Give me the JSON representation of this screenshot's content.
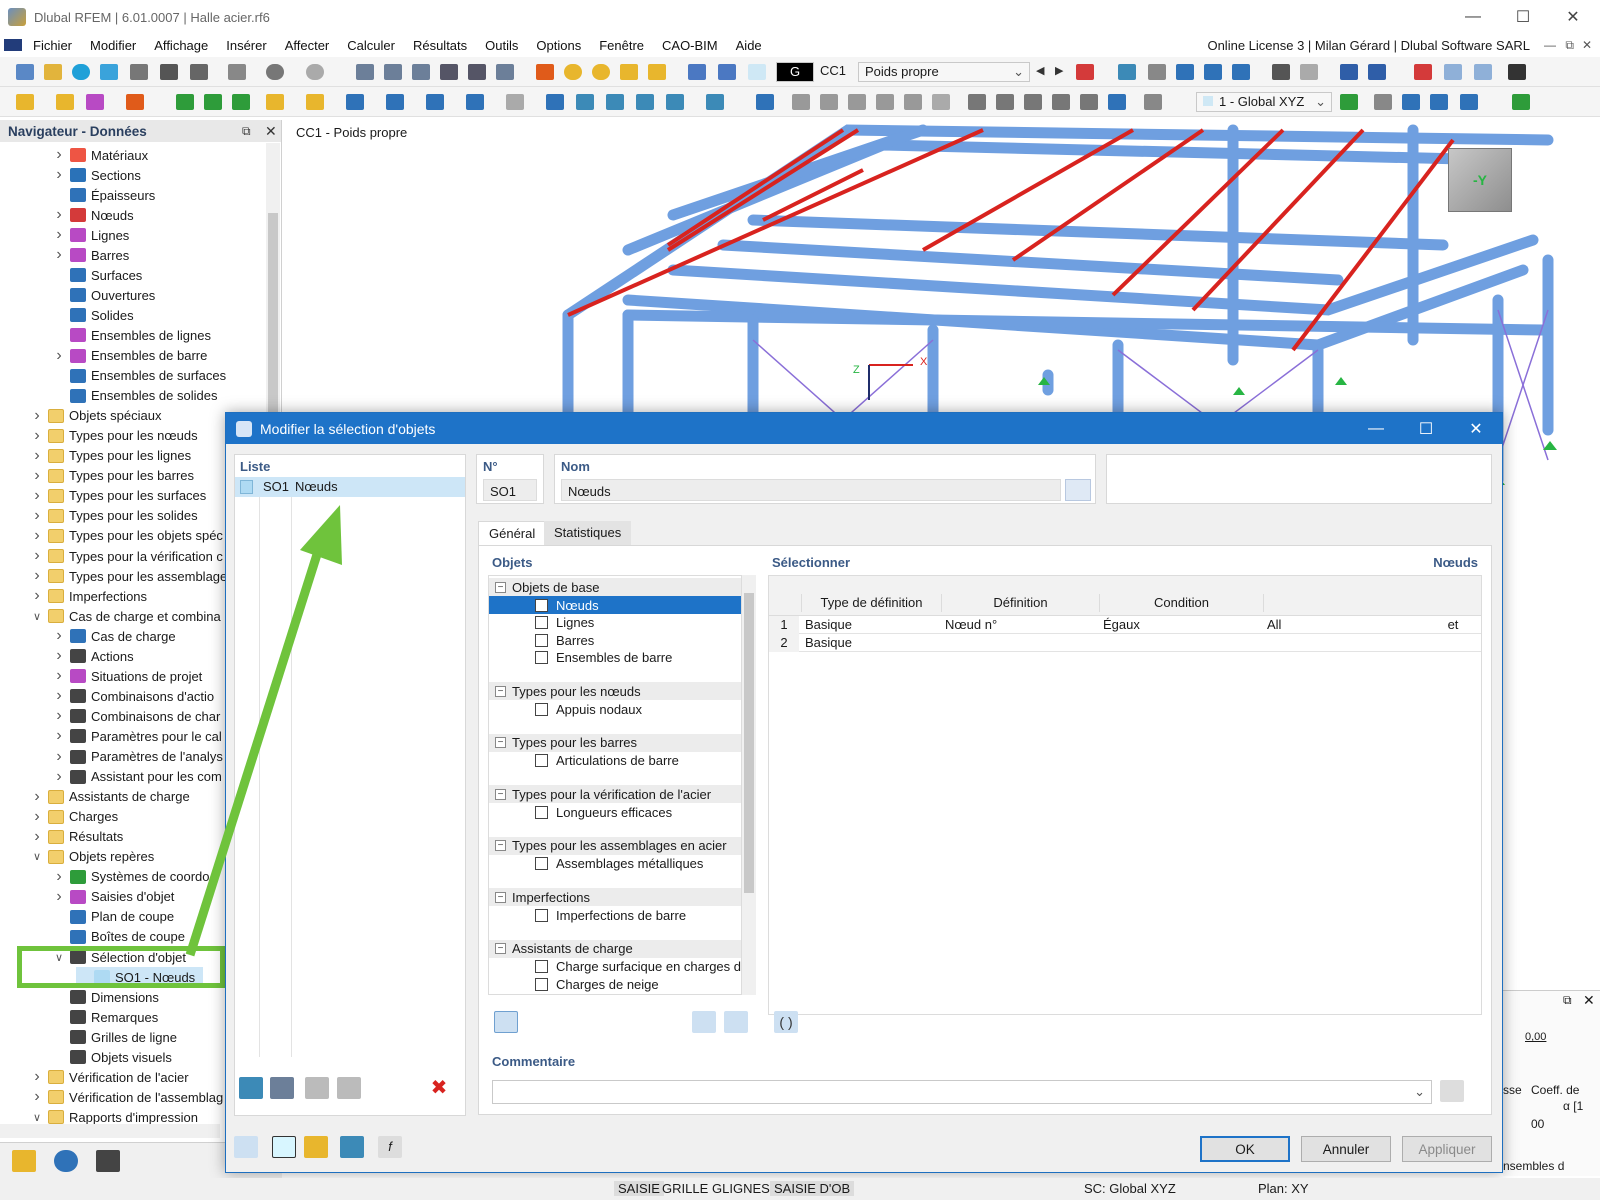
{
  "window": {
    "title": "Dlubal RFEM | 6.01.0007 | Halle acier.rf6"
  },
  "menu": {
    "items": [
      "Fichier",
      "Modifier",
      "Affichage",
      "Insérer",
      "Affecter",
      "Calculer",
      "Résultats",
      "Outils",
      "Options",
      "Fenêtre",
      "CAO-BIM",
      "Aide"
    ],
    "license": "Online License 3 | Milan Gérard | Dlubal Software SARL"
  },
  "toolbar": {
    "lc_code": "G",
    "lc_id": "CC1",
    "lc_name": "Poids propre",
    "coord_system": "1 - Global XYZ"
  },
  "navigator": {
    "title": "Navigateur - Données",
    "items": [
      "Matériaux",
      "Sections",
      "Épaisseurs",
      "Nœuds",
      "Lignes",
      "Barres",
      "Surfaces",
      "Ouvertures",
      "Solides",
      "Ensembles de lignes",
      "Ensembles de barre",
      "Ensembles de surfaces",
      "Ensembles de solides",
      "Objets spéciaux",
      "Types pour les nœuds",
      "Types pour les lignes",
      "Types pour les barres",
      "Types pour les surfaces",
      "Types pour les solides",
      "Types pour les objets spéc",
      "Types pour la vérification c",
      "Types pour les assemblage",
      "Imperfections",
      "Cas de charge et combina",
      "Cas de charge",
      "Actions",
      "Situations de projet",
      "Combinaisons d'actio",
      "Combinaisons de char",
      "Paramètres pour le cal",
      "Paramètres de l'analys",
      "Assistant pour les com",
      "Assistants de charge",
      "Charges",
      "Résultats",
      "Objets repères",
      "Systèmes de coordo",
      "Saisies d'objet",
      "Plan de coupe",
      "Boîtes de coupe",
      "Sélection d'objet",
      "SO1 - Nœuds",
      "Dimensions",
      "Remarques",
      "Grilles de ligne",
      "Objets visuels",
      "Vérification de l'acier",
      "Vérification de l'assemblag",
      "Rapports d'impression"
    ]
  },
  "viewport": {
    "title": "CC1 - Poids propre",
    "axis_x": "X",
    "axis_z": "Z",
    "cube_label": "-Y"
  },
  "dialog": {
    "title": "Modifier la sélection d'objets",
    "list_label": "Liste",
    "list_items": [
      {
        "code": "SO1",
        "name": "Nœuds"
      }
    ],
    "no_label": "N°",
    "no_value": "SO1",
    "name_label": "Nom",
    "name_value": "Nœuds",
    "tabs": [
      "Général",
      "Statistiques"
    ],
    "objects_label": "Objets",
    "tree": [
      {
        "group": "Objets de base",
        "items": [
          {
            "label": "Nœuds",
            "checked": true,
            "selected": true
          },
          {
            "label": "Lignes",
            "checked": false
          },
          {
            "label": "Barres",
            "checked": false
          },
          {
            "label": "Ensembles de barre",
            "checked": false
          }
        ]
      },
      {
        "group": "Types pour les nœuds",
        "items": [
          {
            "label": "Appuis nodaux",
            "checked": false
          }
        ]
      },
      {
        "group": "Types pour les barres",
        "items": [
          {
            "label": "Articulations de barre",
            "checked": false
          }
        ]
      },
      {
        "group": "Types pour la vérification de l'acier",
        "items": [
          {
            "label": "Longueurs efficaces",
            "checked": false
          }
        ]
      },
      {
        "group": "Types pour les assemblages en acier",
        "items": [
          {
            "label": "Assemblages métalliques",
            "checked": false
          }
        ]
      },
      {
        "group": "Imperfections",
        "items": [
          {
            "label": "Imperfections de barre",
            "checked": false
          }
        ]
      },
      {
        "group": "Assistants de charge",
        "items": [
          {
            "label": "Charge surfacique en charges d",
            "checked": false
          },
          {
            "label": "Charges de neige",
            "checked": false
          }
        ]
      }
    ],
    "select_label": "Sélectionner",
    "select_right": "Nœuds",
    "table": {
      "headers": [
        "Type de définition",
        "Définition",
        "Condition",
        ""
      ],
      "rows": [
        [
          "1",
          "Basique",
          "Nœud n°",
          "Égaux",
          "All",
          "et"
        ],
        [
          "2",
          "Basique",
          "",
          "",
          "",
          ""
        ]
      ]
    },
    "paren": "( )",
    "comment_label": "Commentaire",
    "buttons": {
      "ok": "OK",
      "cancel": "Annuler",
      "apply": "Appliquer"
    }
  },
  "background_panel": {
    "value": "0,00",
    "col1": "sse",
    "col2a": "Coeff. de",
    "col2b": "α [1",
    "row": "00",
    "tab": "nsembles d"
  },
  "status": {
    "items": [
      "SAISIE",
      "GRILLE",
      "GLIGNES",
      "SAISIE D'OB"
    ],
    "cs": "SC: Global XYZ",
    "plane": "Plan: XY"
  }
}
